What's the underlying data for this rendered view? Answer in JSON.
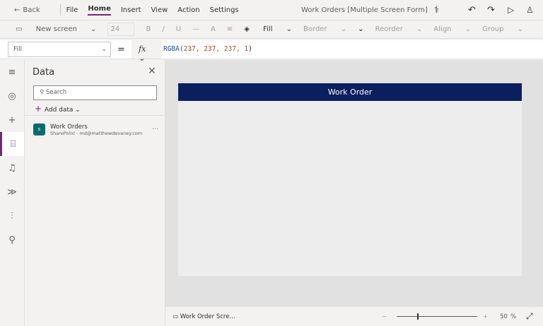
{
  "menu": {
    "back": "Back",
    "items": [
      "File",
      "Home",
      "Insert",
      "View",
      "Action",
      "Settings"
    ],
    "active": "Home",
    "app_title": "Work Orders [Multiple Screen Form]"
  },
  "toolbar": {
    "new_screen": "New screen",
    "font_size": "24",
    "bold": "B",
    "italic": "/",
    "underline": "U",
    "strike": "—",
    "font": "A",
    "align": "≡",
    "fill": "Fill",
    "border": "Border",
    "reorder": "Reorder",
    "align_btn": "Align",
    "group": "Group"
  },
  "formula": {
    "property": "Fill",
    "equals": "=",
    "fx": "fx",
    "func": "RGBA(",
    "args": "237, 237, 237, 1",
    "close": ")"
  },
  "panel": {
    "title": "Data",
    "search_placeholder": "Search",
    "add_data": "Add data",
    "sources": [
      {
        "name": "Work Orders",
        "subtitle": "SharePoint - md@matthewdevaney.com",
        "more": "..."
      }
    ]
  },
  "canvas": {
    "header_title": "Work Order",
    "screen_fill": "#ededed",
    "header_color": "#0b1f5e"
  },
  "status": {
    "screen_name": "Work Order Scre...",
    "zoom_minus": "−",
    "zoom_plus": "+",
    "zoom_value": "50",
    "zoom_unit": "%",
    "zoom_percent": 50
  },
  "colors": {
    "accent": "#742774"
  }
}
